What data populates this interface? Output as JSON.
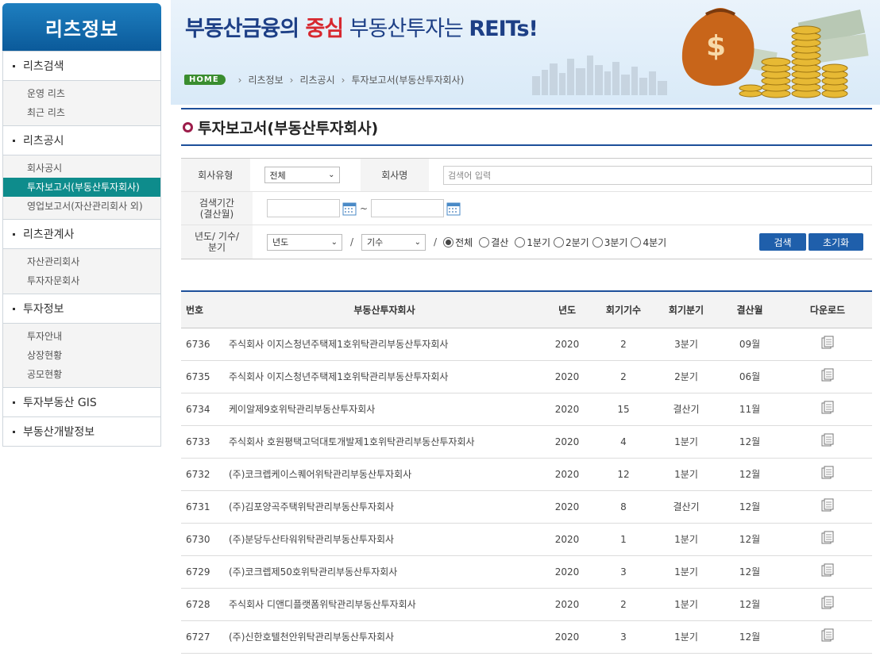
{
  "sidebar": {
    "title": "리츠정보",
    "groups": [
      {
        "label": "리츠검색",
        "items": [
          "운영 리츠",
          "최근 리츠"
        ]
      },
      {
        "label": "리츠공시",
        "items": [
          "회사공시",
          "투자보고서(부동산투자회사)",
          "영업보고서(자산관리회사 외)"
        ]
      },
      {
        "label": "리츠관계사",
        "items": [
          "자산관리회사",
          "투자자문회사"
        ]
      },
      {
        "label": "투자정보",
        "items": [
          "투자안내",
          "상장현황",
          "공모현황"
        ]
      },
      {
        "label": "투자부동산 GIS",
        "items": []
      },
      {
        "label": "부동산개발정보",
        "items": []
      }
    ]
  },
  "banner": {
    "slogan_part1": "부동산금융의 ",
    "slogan_accent": "중심",
    "slogan_part2": " 부동산투자는 ",
    "slogan_part3": "REITs!"
  },
  "breadcrumb": {
    "home": "HOME",
    "items": [
      "리츠정보",
      "리츠공시",
      "투자보고서(부동산투자회사)"
    ]
  },
  "page_title": "투자보고서(부동산투자회사)",
  "search": {
    "company_type_label": "회사유형",
    "company_type_value": "전체",
    "company_name_label": "회사명",
    "company_name_placeholder": "검색어 입력",
    "period_label_1": "검색기간",
    "period_label_2": "(결산월)",
    "period_sep": "~",
    "year_label_1": "년도/ 기수/",
    "year_label_2": "분기",
    "year_select": "년도",
    "term_select": "기수",
    "slash": "/",
    "radio_options": [
      "전체",
      "결산",
      "1분기",
      "2분기",
      "3분기",
      "4분기"
    ],
    "search_btn": "검색",
    "reset_btn": "초기화"
  },
  "table": {
    "headers": [
      "번호",
      "부동산투자회사",
      "년도",
      "회기기수",
      "회기분기",
      "결산월",
      "다운로드"
    ],
    "rows": [
      [
        "6736",
        "주식회사 이지스청년주택제1호위탁관리부동산투자회사",
        "2020",
        "2",
        "3분기",
        "09월"
      ],
      [
        "6735",
        "주식회사 이지스청년주택제1호위탁관리부동산투자회사",
        "2020",
        "2",
        "2분기",
        "06월"
      ],
      [
        "6734",
        "케이알제9호위탁관리부동산투자회사",
        "2020",
        "15",
        "결산기",
        "11월"
      ],
      [
        "6733",
        "주식회사 호원평택고덕대토개발제1호위탁관리부동산투자회사",
        "2020",
        "4",
        "1분기",
        "12월"
      ],
      [
        "6732",
        "(주)코크렙케이스퀘어위탁관리부동산투자회사",
        "2020",
        "12",
        "1분기",
        "12월"
      ],
      [
        "6731",
        "(주)김포양곡주택위탁관리부동산투자회사",
        "2020",
        "8",
        "결산기",
        "12월"
      ],
      [
        "6730",
        "(주)분당두산타워위탁관리부동산투자회사",
        "2020",
        "1",
        "1분기",
        "12월"
      ],
      [
        "6729",
        "(주)코크렙제50호위탁관리부동산투자회사",
        "2020",
        "3",
        "1분기",
        "12월"
      ],
      [
        "6728",
        "주식회사 디앤디플랫폼위탁관리부동산투자회사",
        "2020",
        "2",
        "1분기",
        "12월"
      ],
      [
        "6727",
        "(주)신한호텔천안위탁관리부동산투자회사",
        "2020",
        "3",
        "1분기",
        "12월"
      ]
    ]
  },
  "colors": {
    "brand_blue": "#1d4f9a",
    "accent_red": "#d7282f",
    "active_teal": "#0e8c8c"
  }
}
